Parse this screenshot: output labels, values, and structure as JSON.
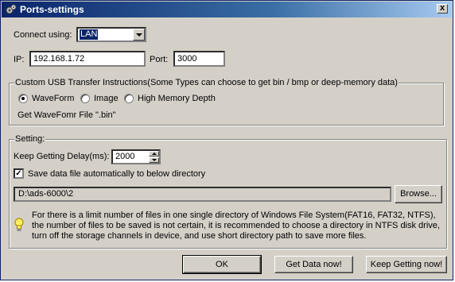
{
  "window": {
    "title": "Ports-settings",
    "close_glyph": "x"
  },
  "connection": {
    "connect_label": "Connect using:",
    "connect_value": "LAN",
    "ip_label": "IP:",
    "ip_value": "192.168.1.72",
    "port_label": "Port:",
    "port_value": "3000"
  },
  "usb_group": {
    "title": "Custom USB Transfer Instructions(Some Types can choose to get bin / bmp or deep-memory data)",
    "options": [
      "WaveForm",
      "Image",
      "High Memory Depth"
    ],
    "selected": "WaveForm",
    "info": "Get WaveFomr File \".bin\""
  },
  "setting_group": {
    "title": "Setting:",
    "delay_label": "Keep Getting Delay(ms):",
    "delay_value": "2000",
    "save_check_label": "Save data file automatically to below directory",
    "save_checked": true,
    "directory": "D:\\ads-6000\\2",
    "browse_label": "Browse...",
    "note_lines": [
      "For there is a limit number of files in one single directory of Windows File System(FAT16, FAT32, NTFS),",
      "the number  of  files to be saved is not certain,  it is recommended to choose a directory in NTFS disk drive,",
      "turn off the storage channels in device, and use short directory path to save more files."
    ]
  },
  "buttons": {
    "ok": "OK",
    "get_data": "Get Data now!",
    "keep_getting": "Keep Getting now!"
  },
  "icons": {
    "title": "gears-icon",
    "note": "lightbulb-icon"
  }
}
